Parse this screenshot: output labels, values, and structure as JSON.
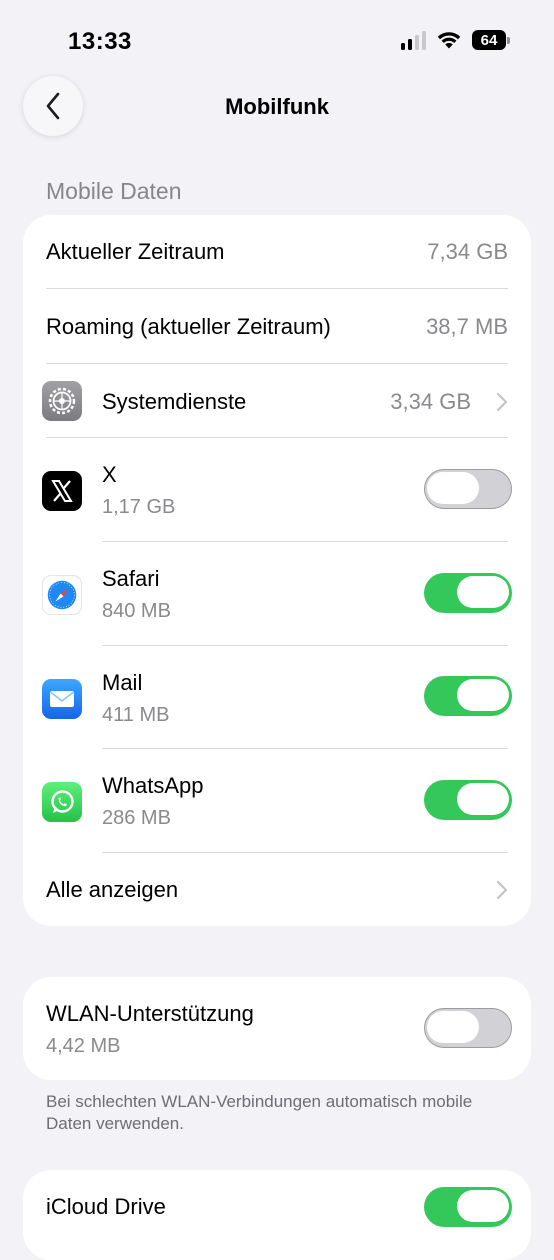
{
  "status_bar": {
    "time": "13:33",
    "battery": "64"
  },
  "nav": {
    "title": "Mobilfunk"
  },
  "mobile_data": {
    "header": "Mobile Daten",
    "current_period": {
      "label": "Aktueller Zeitraum",
      "value": "7,34 GB"
    },
    "roaming": {
      "label": "Roaming (aktueller Zeitraum)",
      "value": "38,7 MB"
    },
    "system_services": {
      "label": "Systemdienste",
      "value": "3,34 GB",
      "icon": "gear-icon"
    },
    "apps": [
      {
        "name": "X",
        "usage": "1,17 GB",
        "enabled": false,
        "icon": "x-app-icon"
      },
      {
        "name": "Safari",
        "usage": "840 MB",
        "enabled": true,
        "icon": "safari-app-icon"
      },
      {
        "name": "Mail",
        "usage": "411 MB",
        "enabled": true,
        "icon": "mail-app-icon"
      },
      {
        "name": "WhatsApp",
        "usage": "286 MB",
        "enabled": true,
        "icon": "whatsapp-app-icon"
      }
    ],
    "show_all": {
      "label": "Alle anzeigen"
    }
  },
  "wifi_assist": {
    "label": "WLAN-Unterstützung",
    "usage": "4,42 MB",
    "enabled": false,
    "footnote": "Bei schlechten WLAN-Verbindungen automatisch mobile Daten verwenden."
  },
  "icloud_drive": {
    "label": "iCloud Drive",
    "enabled": true
  },
  "colors": {
    "accent_green": "#34c759",
    "background": "#f2f2f7",
    "secondary_text": "#8a8a8e"
  }
}
